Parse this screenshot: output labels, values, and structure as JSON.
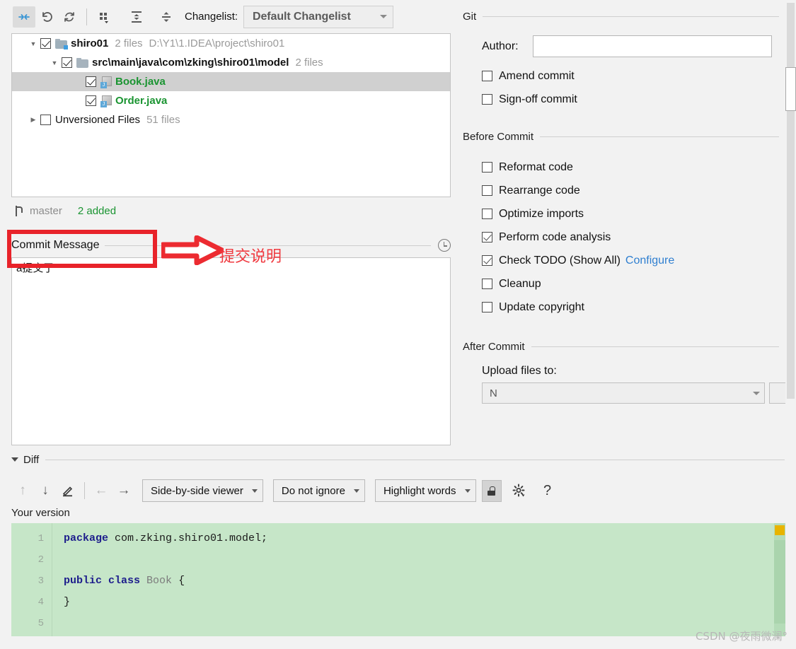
{
  "toolbar": {
    "icons": [
      {
        "name": "show-diff-icon",
        "glyph": "arrows-in",
        "active": true
      },
      {
        "name": "revert-icon",
        "glyph": "undo"
      },
      {
        "name": "refresh-icon",
        "glyph": "refresh"
      },
      {
        "name": "group-by-icon",
        "glyph": "group-by"
      },
      {
        "name": "expand-all-icon",
        "glyph": "expand-all"
      },
      {
        "name": "collapse-all-icon",
        "glyph": "collapse-all"
      }
    ],
    "changelist_label": "Changelist:",
    "changelist_label_mnemonic": "t",
    "changelist_value": "Default Changelist"
  },
  "tree": {
    "rows": [
      {
        "indent": 0,
        "arrow": "down",
        "checked": true,
        "icon": "folder-vcs-icon",
        "name": "shiro01",
        "name_style": "bold",
        "meta": "2 files",
        "path": "D:\\Y1\\1.IDEA\\project\\shiro01",
        "selected": false
      },
      {
        "indent": 1,
        "arrow": "down",
        "checked": true,
        "icon": "folder-icon",
        "name": "src\\main\\java\\com\\zking\\shiro01\\model",
        "name_style": "bold",
        "meta": "2 files",
        "path": "",
        "selected": false
      },
      {
        "indent": 2,
        "arrow": "blank",
        "checked": true,
        "icon": "java-file-icon",
        "name": "Book.java",
        "name_style": "green",
        "meta": "",
        "path": "",
        "selected": true
      },
      {
        "indent": 2,
        "arrow": "blank",
        "checked": true,
        "icon": "java-file-icon",
        "name": "Order.java",
        "name_style": "green",
        "meta": "",
        "path": "",
        "selected": false
      },
      {
        "indent": 0,
        "arrow": "right",
        "checked": false,
        "icon": "none",
        "name": "Unversioned Files",
        "name_style": "plain",
        "meta": "51 files",
        "path": "",
        "selected": false
      }
    ]
  },
  "branch_bar": {
    "branch_name": "master",
    "changes_summary": "2 added"
  },
  "commit_message": {
    "title": "Commit Message",
    "title_mnemonic": "C",
    "value": "a提交了",
    "history_icon": "clock-icon"
  },
  "annotation": {
    "text": "提交说明",
    "color": "#f0393f"
  },
  "right_panel": {
    "git_group": {
      "label": "Git",
      "author_label": "Author:",
      "author_mnemonic": "A",
      "author_value": "",
      "checkboxes": [
        {
          "label": "Amend commit",
          "mnemonic": "m",
          "checked": false,
          "name": "amend-commit-checkbox"
        },
        {
          "label": "Sign-off commit",
          "mnemonic": "g",
          "checked": false,
          "name": "sign-off-commit-checkbox"
        }
      ]
    },
    "before_commit_group": {
      "label": "Before Commit",
      "checkboxes": [
        {
          "label": "Reformat code",
          "mnemonic": "R",
          "checked": false,
          "name": "reformat-code-checkbox"
        },
        {
          "label": "Rearrange code",
          "mnemonic": "n",
          "checked": false,
          "name": "rearrange-code-checkbox"
        },
        {
          "label": "Optimize imports",
          "mnemonic": "O",
          "checked": false,
          "name": "optimize-imports-checkbox"
        },
        {
          "label": "Perform code analysis",
          "mnemonic": "s",
          "checked": true,
          "name": "perform-code-analysis-checkbox"
        },
        {
          "label": "Check TODO (Show All)",
          "mnemonic": "",
          "checked": true,
          "link": "Configure",
          "name": "check-todo-checkbox"
        },
        {
          "label": "Cleanup",
          "mnemonic": "l",
          "checked": false,
          "name": "cleanup-checkbox"
        },
        {
          "label": "Update copyright",
          "mnemonic": "",
          "checked": false,
          "name": "update-copyright-checkbox"
        }
      ]
    },
    "after_commit_group": {
      "label": "After Commit",
      "upload_label": "Upload files to:",
      "upload_value": "N"
    }
  },
  "diff": {
    "section_label": "Diff",
    "toolbar": {
      "prev_diff_icon": "arrow-up-icon",
      "next_diff_icon": "arrow-down-icon",
      "edit_icon": "pencil-icon",
      "accept_left_icon": "arrow-left-icon",
      "accept_right_icon": "arrow-right-icon",
      "viewer_mode": "Side-by-side viewer",
      "whitespace_mode": "Do not ignore",
      "highlight_mode": "Highlight words",
      "lock_icon": "lock-icon",
      "settings_icon": "gear-icon",
      "help_icon": "question-mark-icon"
    },
    "version_label": "Your version",
    "code_lines": [
      {
        "num": "1",
        "tokens": [
          {
            "t": "package",
            "c": "kw"
          },
          {
            "t": " com.zking.shiro01.model;",
            "c": ""
          }
        ]
      },
      {
        "num": "2",
        "tokens": []
      },
      {
        "num": "3",
        "tokens": [
          {
            "t": "public class",
            "c": "kw"
          },
          {
            "t": " ",
            "c": ""
          },
          {
            "t": "Book",
            "c": "cls"
          },
          {
            "t": " {",
            "c": ""
          }
        ]
      },
      {
        "num": "4",
        "tokens": [
          {
            "t": "}",
            "c": ""
          }
        ]
      },
      {
        "num": "5",
        "tokens": []
      }
    ]
  },
  "watermark": "CSDN @夜雨微澜°"
}
